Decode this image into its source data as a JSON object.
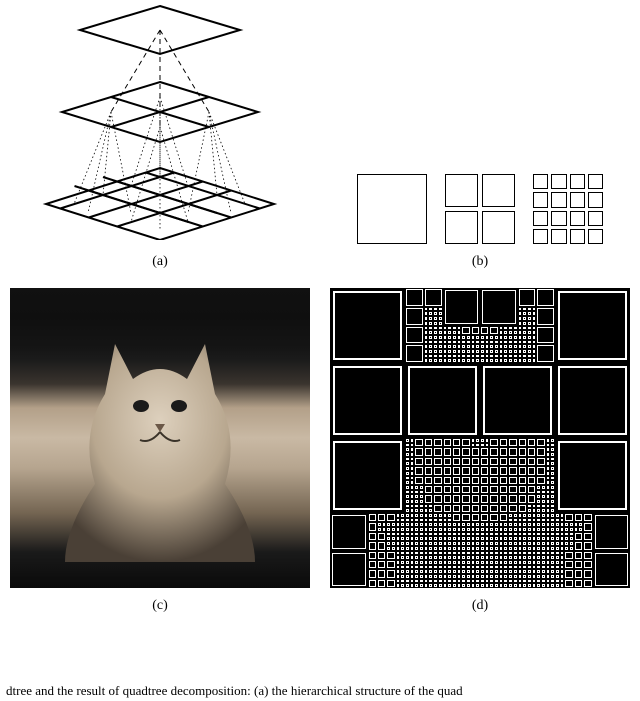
{
  "labels": {
    "a": "(a)",
    "b": "(b)",
    "c": "(c)",
    "d": "(d)"
  },
  "caption_fragment": "dtree and the result of quadtree decomposition: (a) the hierarchical structure of the quad",
  "panel_b": {
    "levels": [
      {
        "n": 1,
        "outer": 70
      },
      {
        "n": 2,
        "outer": 70
      },
      {
        "n": 4,
        "outer": 70
      }
    ]
  },
  "icons": {
    "pyramid": "quadtree-pyramid-diagram",
    "cat": "cat-photo",
    "quadtree_result": "quadtree-decomposition-result"
  }
}
